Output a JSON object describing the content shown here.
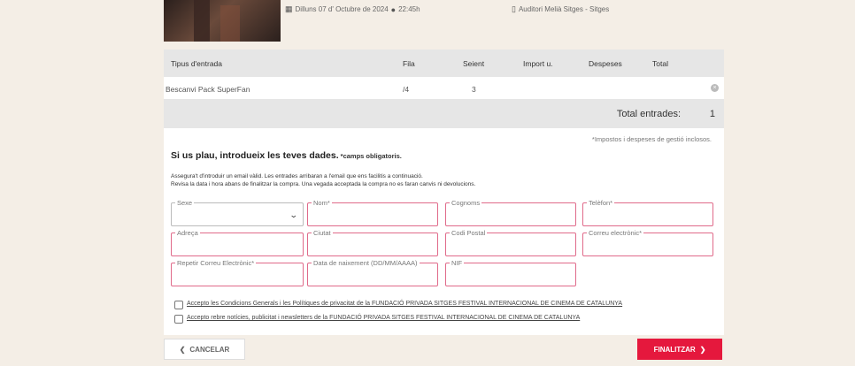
{
  "event": {
    "date_icon": "calendar-icon",
    "date": "Dilluns 07 d' Octubre de 2024",
    "time_icon": "clock-icon",
    "time": "22:45h",
    "venue_icon": "map-pin-icon",
    "venue": "Auditori Melià Sitges - Sitges"
  },
  "table": {
    "headers": [
      "Tipus d'entrada",
      "Fila",
      "Seient",
      "Import u.",
      "Despeses",
      "Total"
    ],
    "rows": [
      {
        "type": "Bescanvi Pack SuperFan",
        "row": "/4",
        "seat": "3",
        "price": "",
        "fees": "",
        "total": ""
      }
    ],
    "total_label": "Total entrades:",
    "total_value": "1",
    "taxes_note": "*Impostos i despeses de gestió inclosos."
  },
  "form": {
    "title": "Si us plau, introdueix les teves dades.",
    "required_note": "*camps obligatoris.",
    "note_line1": "Assegura't d'introduir un email vàlid. Les entrades arribaran a l'email que ens facilitis a continuació.",
    "note_line2": "Revisa la data i hora abans de finalitzar la compra. Una vegada acceptada la compra no es faran canvis ni devolucions.",
    "fields": {
      "sexe": "Sexe",
      "nom": "Nom*",
      "cognoms": "Cognoms",
      "telefon": "Telèfon*",
      "adreca": "Adreça",
      "ciutat": "Ciutat",
      "codi_postal": "Codi Postal",
      "correu": "Correu electrònic*",
      "repetir_correu": "Repetir Correu Electrònic*",
      "naixement": "Data de naixement (DD/MM/AAAA)",
      "nif": "NIF"
    },
    "check1": "Accepto les Condicions Generals i les Polítiques de privacitat de la FUNDACIÓ PRIVADA SITGES FESTIVAL INTERNACIONAL DE CINEMA DE CATALUNYA",
    "check2": "Accepto rebre notícies, publicitat i newsletters de la FUNDACIÓ PRIVADA SITGES FESTIVAL INTERNACIONAL DE CINEMA DE CATALUNYA"
  },
  "buttons": {
    "cancel": "CANCELAR",
    "finish": "FINALITZAR"
  },
  "colors": {
    "accent": "#e5183d",
    "field_border": "#e06a8a",
    "page_bg": "#f4eee6"
  }
}
